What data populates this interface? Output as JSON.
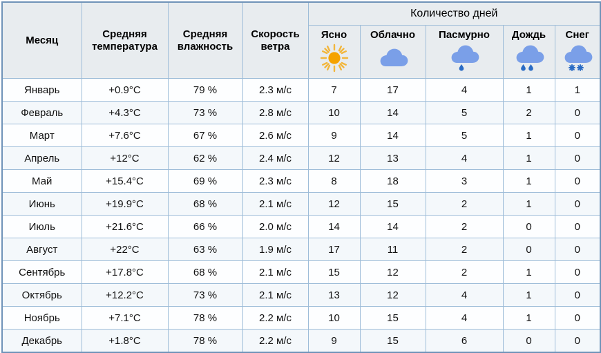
{
  "table": {
    "group_header": {
      "days_group_label": "Количество дней"
    },
    "columns": {
      "month": "Месяц",
      "avg_temperature": "Средняя температура",
      "avg_humidity": "Средняя влажность",
      "wind_speed": "Скорость ветра",
      "clear": "Ясно",
      "cloudy": "Облачно",
      "overcast": "Пасмурно",
      "rain": "Дождь",
      "snow": "Снег"
    },
    "icons": {
      "clear": "sun-icon",
      "cloudy": "cloud-icon",
      "overcast": "cloud-drizzle-icon",
      "rain": "cloud-rain-icon",
      "snow": "cloud-snow-icon"
    },
    "colors": {
      "sun": "#f5a200",
      "sun_rays": "#f2b63c",
      "cloud": "#7a9fe8",
      "drop": "#2a6bc4",
      "snowflake": "#2a6bc4",
      "header_bg": "#e8ecef",
      "border": "#9dbcd8",
      "outer_border": "#6f93b8"
    },
    "rows": [
      {
        "month": "Январь",
        "temp": "+0.9°C",
        "humidity": "79 %",
        "wind": "2.3 м/с",
        "clear": "7",
        "cloudy": "17",
        "overcast": "4",
        "rain": "1",
        "snow": "1"
      },
      {
        "month": "Февраль",
        "temp": "+4.3°C",
        "humidity": "73 %",
        "wind": "2.8 м/с",
        "clear": "10",
        "cloudy": "14",
        "overcast": "5",
        "rain": "2",
        "snow": "0"
      },
      {
        "month": "Март",
        "temp": "+7.6°C",
        "humidity": "67 %",
        "wind": "2.6 м/с",
        "clear": "9",
        "cloudy": "14",
        "overcast": "5",
        "rain": "1",
        "snow": "0"
      },
      {
        "month": "Апрель",
        "temp": "+12°C",
        "humidity": "62 %",
        "wind": "2.4 м/с",
        "clear": "12",
        "cloudy": "13",
        "overcast": "4",
        "rain": "1",
        "snow": "0"
      },
      {
        "month": "Май",
        "temp": "+15.4°C",
        "humidity": "69 %",
        "wind": "2.3 м/с",
        "clear": "8",
        "cloudy": "18",
        "overcast": "3",
        "rain": "1",
        "snow": "0"
      },
      {
        "month": "Июнь",
        "temp": "+19.9°C",
        "humidity": "68 %",
        "wind": "2.1 м/с",
        "clear": "12",
        "cloudy": "15",
        "overcast": "2",
        "rain": "1",
        "snow": "0"
      },
      {
        "month": "Июль",
        "temp": "+21.6°C",
        "humidity": "66 %",
        "wind": "2.0 м/с",
        "clear": "14",
        "cloudy": "14",
        "overcast": "2",
        "rain": "0",
        "snow": "0"
      },
      {
        "month": "Август",
        "temp": "+22°C",
        "humidity": "63 %",
        "wind": "1.9 м/с",
        "clear": "17",
        "cloudy": "11",
        "overcast": "2",
        "rain": "0",
        "snow": "0"
      },
      {
        "month": "Сентябрь",
        "temp": "+17.8°C",
        "humidity": "68 %",
        "wind": "2.1 м/с",
        "clear": "15",
        "cloudy": "12",
        "overcast": "2",
        "rain": "1",
        "snow": "0"
      },
      {
        "month": "Октябрь",
        "temp": "+12.2°C",
        "humidity": "73 %",
        "wind": "2.1 м/с",
        "clear": "13",
        "cloudy": "12",
        "overcast": "4",
        "rain": "1",
        "snow": "0"
      },
      {
        "month": "Ноябрь",
        "temp": "+7.1°C",
        "humidity": "78 %",
        "wind": "2.2 м/с",
        "clear": "10",
        "cloudy": "15",
        "overcast": "4",
        "rain": "1",
        "snow": "0"
      },
      {
        "month": "Декабрь",
        "temp": "+1.8°C",
        "humidity": "78 %",
        "wind": "2.2 м/с",
        "clear": "9",
        "cloudy": "15",
        "overcast": "6",
        "rain": "0",
        "snow": "0"
      }
    ]
  }
}
